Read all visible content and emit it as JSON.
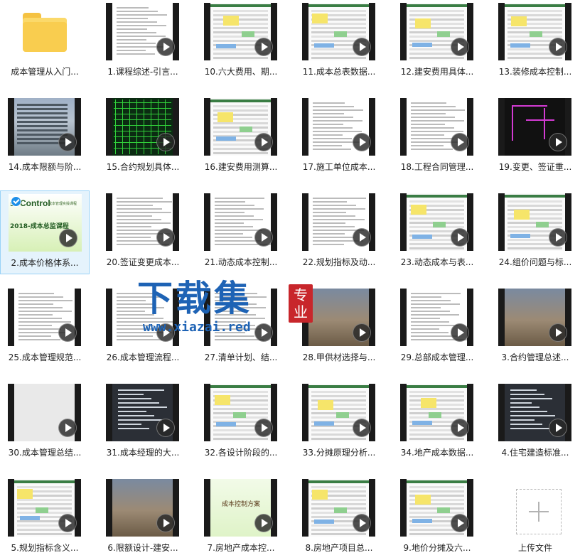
{
  "items": [
    {
      "label": "成本管理从入门...",
      "kind": "folder"
    },
    {
      "label": "1.课程综述-引言...",
      "kind": "doc"
    },
    {
      "label": "10.六大费用、期...",
      "kind": "sheet"
    },
    {
      "label": "11.成本总表数据...",
      "kind": "sheet"
    },
    {
      "label": "12.建安费用具体...",
      "kind": "sheet"
    },
    {
      "label": "13.装修成本控制...",
      "kind": "sheet"
    },
    {
      "label": "14.成本限额与阶...",
      "kind": "building"
    },
    {
      "label": "15.合约规划具体...",
      "kind": "cad"
    },
    {
      "label": "16.建安费用测算...",
      "kind": "sheet"
    },
    {
      "label": "17.施工单位成本...",
      "kind": "doc"
    },
    {
      "label": "18.工程合同管理...",
      "kind": "doc"
    },
    {
      "label": "19.变更、签证重...",
      "kind": "cad2"
    },
    {
      "label": "2.成本价格体系...",
      "kind": "cover",
      "selected": true
    },
    {
      "label": "20.签证变更成本...",
      "kind": "doc"
    },
    {
      "label": "21.动态成本控制...",
      "kind": "doc"
    },
    {
      "label": "22.规划指标及动...",
      "kind": "doc"
    },
    {
      "label": "23.动态成本与表...",
      "kind": "sheet"
    },
    {
      "label": "24.组价问题与标...",
      "kind": "sheet"
    },
    {
      "label": "25.成本管理规范...",
      "kind": "doc"
    },
    {
      "label": "26.成本管理流程...",
      "kind": "doc"
    },
    {
      "label": "27.清单计划、结...",
      "kind": "doc"
    },
    {
      "label": "28.甲供材选择与...",
      "kind": "photo"
    },
    {
      "label": "29.总部成本管理...",
      "kind": "doc"
    },
    {
      "label": "3.合约管理总述...",
      "kind": "photo"
    },
    {
      "label": "30.成本管理总结...",
      "kind": "gray"
    },
    {
      "label": "31.成本经理的大...",
      "kind": "dark"
    },
    {
      "label": "32.各设计阶段的...",
      "kind": "sheet"
    },
    {
      "label": "33.分摊原理分析...",
      "kind": "sheet"
    },
    {
      "label": "34.地产成本数据...",
      "kind": "sheet"
    },
    {
      "label": "4.住宅建造标准...",
      "kind": "dark"
    },
    {
      "label": "5.规划指标含义...",
      "kind": "sheet"
    },
    {
      "label": "6.限额设计-建安...",
      "kind": "photo"
    },
    {
      "label": "7.房地产成本控...",
      "kind": "green"
    },
    {
      "label": "8.房地产项目总...",
      "kind": "sheet"
    },
    {
      "label": "9.地价分摊及六...",
      "kind": "sheet"
    },
    {
      "label": "上传文件",
      "kind": "upload"
    }
  ],
  "cover": {
    "title": "st Control",
    "subtitle": "2018-成本总监课程",
    "note": "成本管理实操课程"
  },
  "green_thumb": {
    "title": "成本控制方案"
  },
  "watermark": {
    "brand": "下载集",
    "url": "www.xiazai.red",
    "seal": "专业"
  }
}
